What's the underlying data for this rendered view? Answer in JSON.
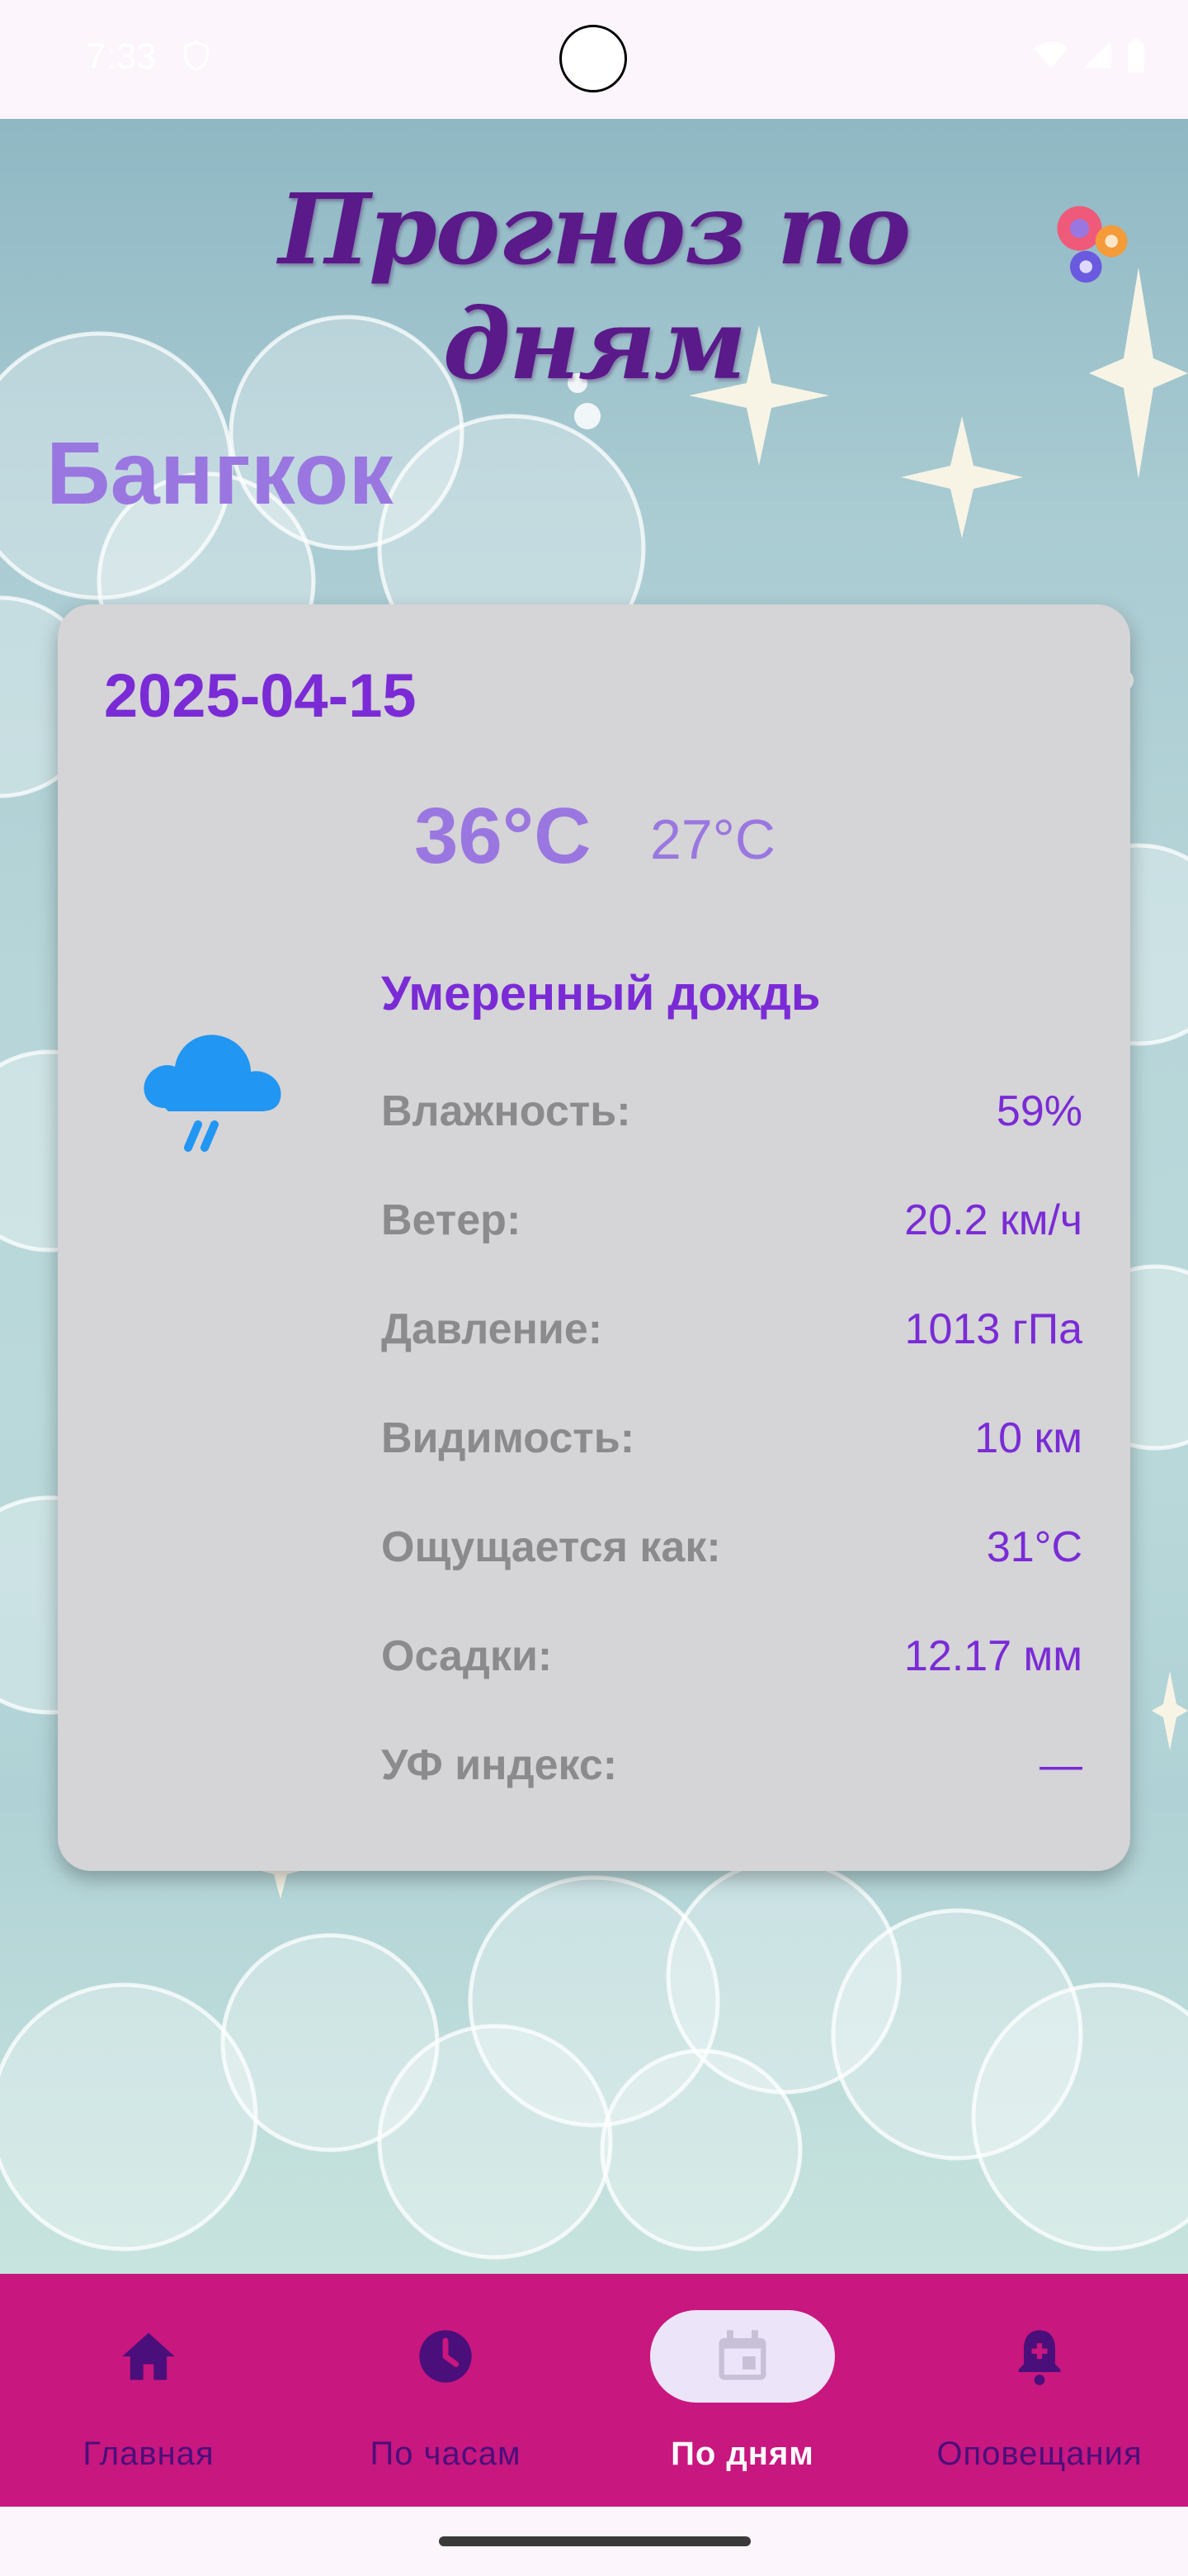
{
  "status_bar": {
    "time": "7:33"
  },
  "header": {
    "title": "Прогноз по дням",
    "settings_icon": "gears-icon"
  },
  "city": "Бангкок",
  "forecast": {
    "date": "2025-04-15",
    "temp_max": "36°C",
    "temp_min": "27°C",
    "condition": "Умеренный дождь",
    "icon": "rain-cloud-icon",
    "details": [
      {
        "label": "Влажность:",
        "value": "59%"
      },
      {
        "label": "Ветер:",
        "value": "20.2 км/ч"
      },
      {
        "label": "Давление:",
        "value": "1013 гПа"
      },
      {
        "label": "Видимость:",
        "value": "10 км"
      },
      {
        "label": "Ощущается как:",
        "value": "31°C"
      },
      {
        "label": "Осадки:",
        "value": "12.17 мм"
      },
      {
        "label": "УФ индекс:",
        "value": "—"
      }
    ]
  },
  "nav": {
    "items": [
      {
        "label": "Главная",
        "icon": "home-icon",
        "active": false
      },
      {
        "label": "По часам",
        "icon": "clock-icon",
        "active": false
      },
      {
        "label": "По дням",
        "icon": "calendar-icon",
        "active": true
      },
      {
        "label": "Оповещания",
        "icon": "bell-icon",
        "active": false
      }
    ]
  },
  "colors": {
    "accent": "#7a2bd6",
    "title": "#5a1a8a",
    "city": "#9a77e0",
    "nav_bg": "#c8177f",
    "card_bg": "#d5d4d6"
  }
}
